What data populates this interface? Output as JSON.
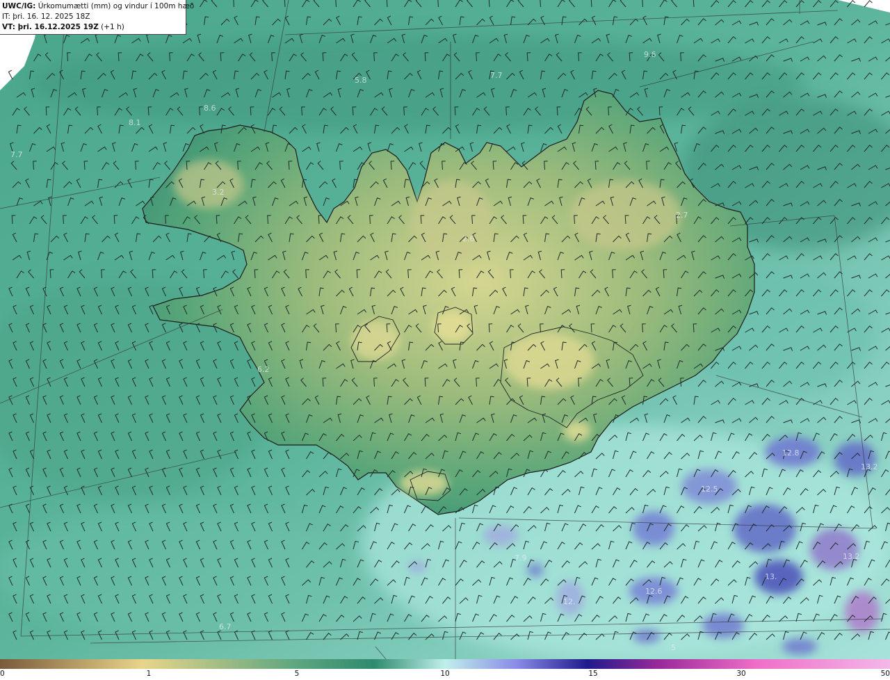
{
  "title": {
    "prefix": "UWC/IG:",
    "main": " Úrkomumætti (mm) og vindur í 100m hæð",
    "it_line": "IT: þri. 16. 12. 2025 18Z",
    "vt_bold": "VT: þri. 16.12.2025 19Z",
    "vt_suffix": " (+1 h)"
  },
  "colors": {
    "sea": "#7fcdc0",
    "sea_dark": "#3e9a83",
    "land_low": "#4f9f76",
    "land_mid": "#8fb77a",
    "land_high": "#d7d692",
    "precip_blue": "#6b6fd0",
    "precip_purple": "#b36fc9",
    "coast": "#222222",
    "barb": "#1d2b29"
  },
  "colorbar": {
    "ticks": [
      "0",
      "1",
      "5",
      "10",
      "15",
      "30",
      "50"
    ],
    "stops": [
      "#7a5a3c",
      "#e8d48a",
      "#5fa77f",
      "#2f8a6f",
      "#bff0ea",
      "#8a8ce8",
      "#1f1a8c",
      "#9a2a9a",
      "#ee6fc8",
      "#f3b8e8"
    ]
  },
  "value_labels": [
    "5.8",
    "9.6",
    "7.7",
    "8.6",
    "8.1",
    "7.7",
    "3.2",
    "2.6",
    "2.7",
    "6.2",
    "12.8",
    "13.2",
    "12.5",
    "13.2",
    "13.",
    "12.6",
    "7.9",
    "12.",
    "6.7",
    "5"
  ]
}
